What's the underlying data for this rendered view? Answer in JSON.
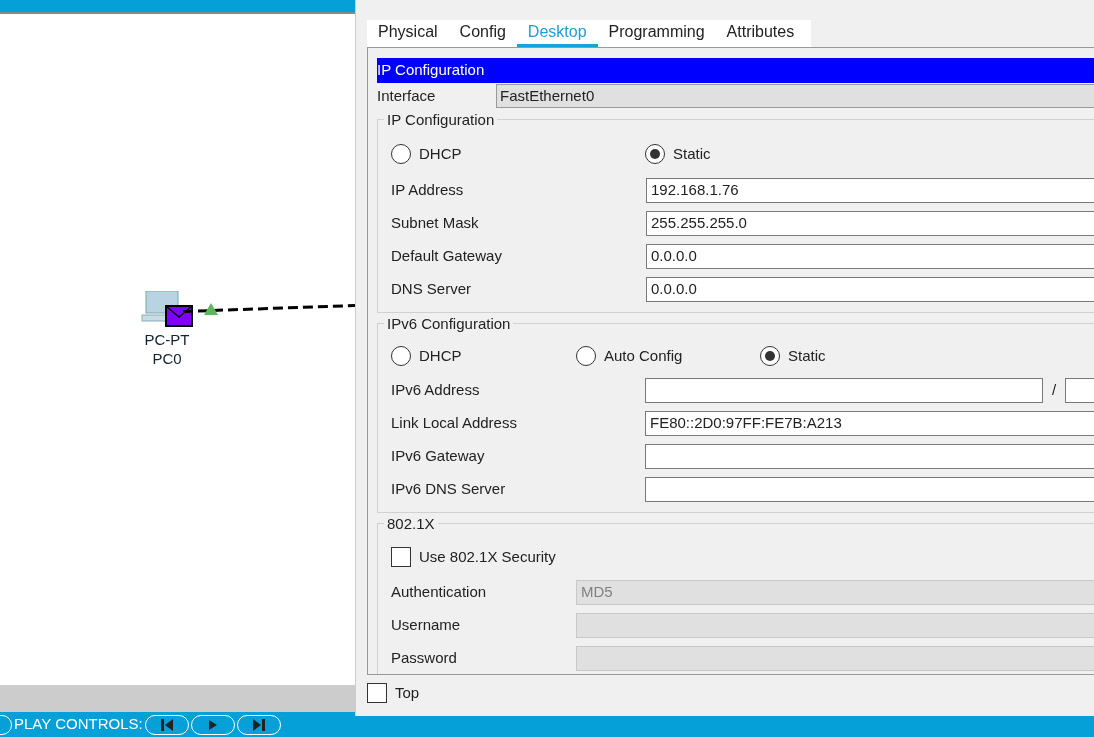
{
  "canvas": {
    "device": {
      "model": "PC-PT",
      "name": "PC0"
    }
  },
  "play_controls": {
    "label": "PLAY CONTROLS:"
  },
  "dialog": {
    "tabs": [
      {
        "label": "Physical",
        "selected": false
      },
      {
        "label": "Config",
        "selected": false
      },
      {
        "label": "Desktop",
        "selected": true
      },
      {
        "label": "Programming",
        "selected": false
      },
      {
        "label": "Attributes",
        "selected": false
      }
    ],
    "header": "IP Configuration",
    "interface": {
      "label": "Interface",
      "value": "FastEthernet0"
    },
    "ipv4": {
      "title": "IP Configuration",
      "modes": [
        {
          "label": "DHCP",
          "selected": false
        },
        {
          "label": "Static",
          "selected": true
        }
      ],
      "fields": [
        {
          "label": "IP Address",
          "value": "192.168.1.76"
        },
        {
          "label": "Subnet Mask",
          "value": "255.255.255.0"
        },
        {
          "label": "Default Gateway",
          "value": "0.0.0.0"
        },
        {
          "label": "DNS Server",
          "value": "0.0.0.0"
        }
      ]
    },
    "ipv6": {
      "title": "IPv6 Configuration",
      "modes": [
        {
          "label": "DHCP",
          "selected": false
        },
        {
          "label": "Auto Config",
          "selected": false
        },
        {
          "label": "Static",
          "selected": true
        }
      ],
      "address": {
        "label": "IPv6 Address",
        "separator": "/"
      },
      "fields": [
        {
          "label": "Link Local Address",
          "value": "FE80::2D0:97FF:FE7B:A213"
        },
        {
          "label": "IPv6 Gateway"
        },
        {
          "label": "IPv6 DNS Server"
        }
      ]
    },
    "dot1x": {
      "title": "802.1X",
      "security": {
        "label": "Use 802.1X Security",
        "checked": false
      },
      "fields": [
        {
          "label": "Authentication",
          "value": "MD5"
        },
        {
          "label": "Username"
        },
        {
          "label": "Password"
        }
      ]
    },
    "top": {
      "label": "Top",
      "checked": false
    }
  }
}
